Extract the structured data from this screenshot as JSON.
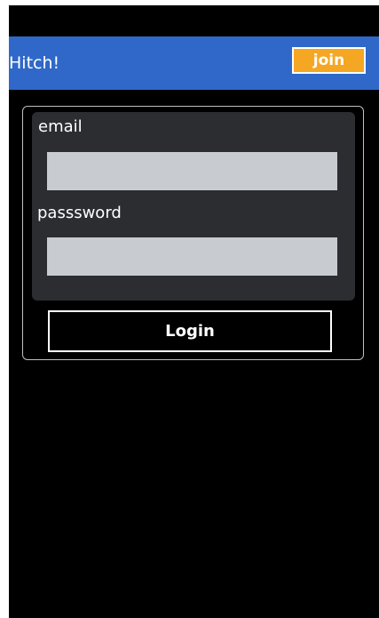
{
  "header": {
    "title": "Hitch!",
    "join_label": "join"
  },
  "login_form": {
    "email_label": "email",
    "email_value": "",
    "password_label": "passsword",
    "password_value": "",
    "login_label": "Login"
  },
  "colors": {
    "header_bg": "#2f68c8",
    "join_bg": "#f5a623",
    "panel_bg": "#2b2d31",
    "input_bg": "#c8cbd0",
    "screen_bg": "#000000"
  }
}
